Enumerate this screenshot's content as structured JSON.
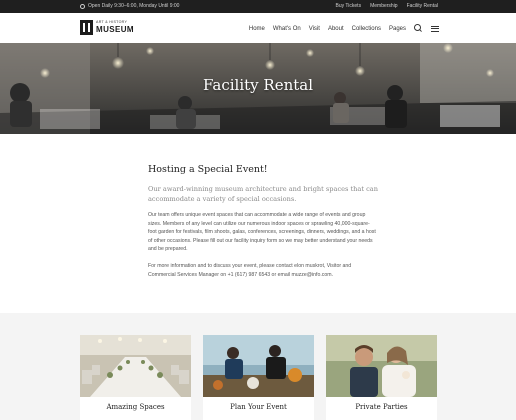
{
  "topbar": {
    "hours": "Open Daily 9:30–6:00, Monday Until 9:00",
    "links": [
      "Buy Tickets",
      "Membership",
      "Facility Rental"
    ]
  },
  "header": {
    "logo_small": "ART & HISTORY",
    "logo_big": "MUSEUM",
    "nav": [
      "Home",
      "What's On",
      "Visit",
      "About",
      "Collections",
      "Pages"
    ]
  },
  "hero": {
    "title": "Facility Rental"
  },
  "content": {
    "heading": "Hosting a Special Event!",
    "lead": "Our award-winning museum architecture and bright spaces that can accommodate a variety of special occasions.",
    "paragraph1": "Our team offers unique event spaces that can accommodate a wide range of events and group sizes. Members of any level can utilize our numerous indoor spaces or sprawling 40,000-square-foot garden for festivals, film shoots, galas, conferences, screenings, dinners, weddings, and a host of other occasions. Please fill out our facility inquiry form so we may better understand your needs and be prepared.",
    "paragraph2": "For more information and to discuss your event, please contact elon muskrot, Visitor and Commercial Services Manager on +1 (617) 987 6543 or email muzze@info.com."
  },
  "cards": [
    {
      "label": "Amazing Spaces"
    },
    {
      "label": "Plan Your Event"
    },
    {
      "label": "Private Parties"
    }
  ],
  "colors": {
    "topbar": "#1f1f1f",
    "section_bg": "#f4f4f4",
    "text_dark": "#222222",
    "text_muted": "#8a8a8a"
  }
}
